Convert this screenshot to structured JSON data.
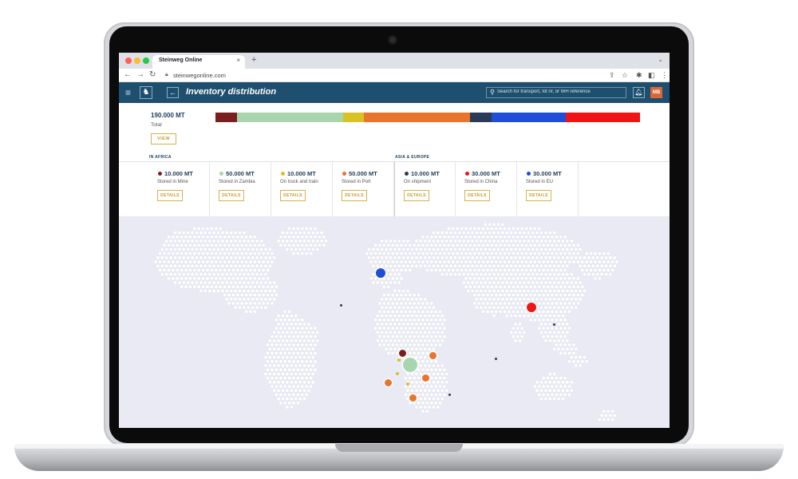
{
  "browser": {
    "tab_title": "Steinweg Online",
    "tab_close": "×",
    "new_tab": "+",
    "url": "steinwegonline.com"
  },
  "header": {
    "title": "Inventory distribution",
    "search_placeholder": "Search for transport, lot nr, or WH reference",
    "avatar_initials": "MB"
  },
  "summary": {
    "total_value": "190.000 MT",
    "total_label": "Total",
    "view_label": "VIEW",
    "distribution": [
      {
        "color": "#7a1f1f",
        "share": 0.0526
      },
      {
        "color": "#a8d5b0",
        "share": 0.2632
      },
      {
        "color": "#d9c226",
        "share": 0.0526
      },
      {
        "color": "#e8742e",
        "share": 0.2632
      },
      {
        "color": "#2b3a56",
        "share": 0.0526
      },
      {
        "color": "#1f4fd8",
        "share": 0.1842
      },
      {
        "color": "#f01414",
        "share": 0.1842
      }
    ]
  },
  "sections": {
    "africa": "IN AFRICA",
    "asia_europe": "ASIA & EUROPE"
  },
  "cards": [
    {
      "value": "10.000 MT",
      "label": "Stored in Mine",
      "color": "#7a1f1f",
      "button": "DETAILS"
    },
    {
      "value": "50.000 MT",
      "label": "Stored in Zambia",
      "color": "#a8d5b0",
      "button": "DETAILS"
    },
    {
      "value": "10.000 MT",
      "label": "On truck and train",
      "color": "#d9c226",
      "button": "DETAILS"
    },
    {
      "value": "50.000 MT",
      "label": "Stored in Port",
      "color": "#e8742e",
      "button": "DETAILS"
    },
    {
      "value": "10.000 MT",
      "label": "On shipment",
      "color": "#2b3a56",
      "button": "DETAILS"
    },
    {
      "value": "30.000 MT",
      "label": "Stored in China",
      "color": "#f01414",
      "button": "DETAILS"
    },
    {
      "value": "30.000 MT",
      "label": "Stored in EU",
      "color": "#1f4fd8",
      "button": "DETAILS"
    }
  ],
  "icons": {
    "menu": "menu-icon",
    "back": "arrow-left-icon",
    "search": "search-icon",
    "bell": "bell-icon"
  }
}
